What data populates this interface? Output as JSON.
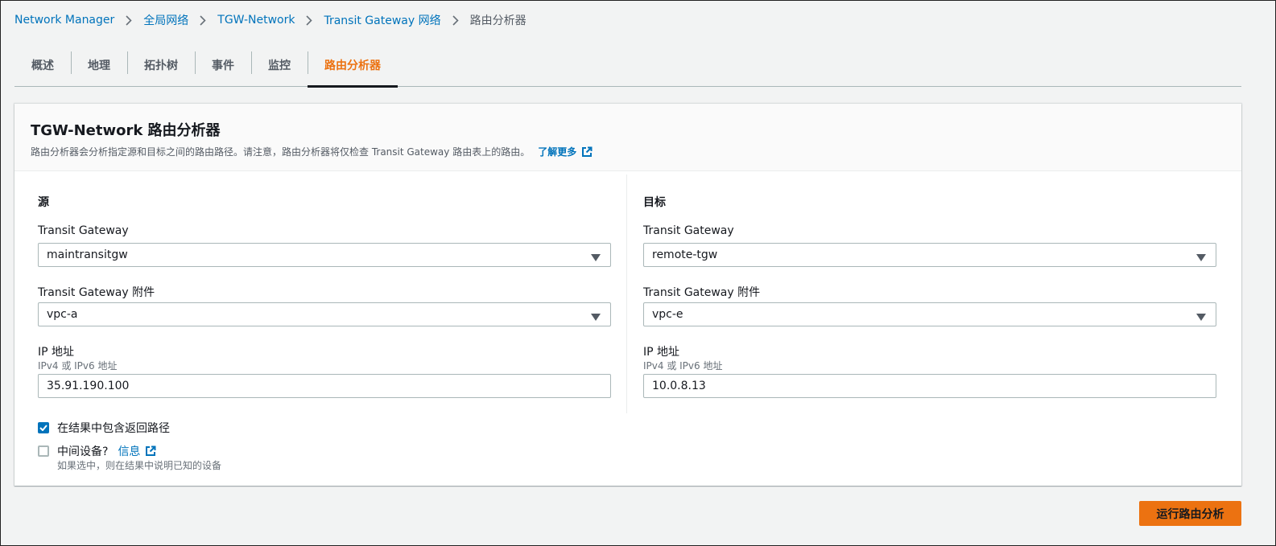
{
  "breadcrumb": [
    {
      "label": "Network Manager"
    },
    {
      "label": "全局网络"
    },
    {
      "label": "TGW-Network"
    },
    {
      "label": "Transit Gateway 网络"
    },
    {
      "label": "路由分析器"
    }
  ],
  "tabs": [
    {
      "label": "概述"
    },
    {
      "label": "地理"
    },
    {
      "label": "拓扑树"
    },
    {
      "label": "事件"
    },
    {
      "label": "监控"
    },
    {
      "label": "路由分析器",
      "active": true
    }
  ],
  "panel": {
    "title": "TGW-Network 路由分析器",
    "description": "路由分析器会分析指定源和目标之间的路由路径。请注意，路由分析器将仅检查 Transit Gateway 路由表上的路由。",
    "learn_more": "了解更多"
  },
  "source": {
    "title": "源",
    "tgw_label": "Transit Gateway",
    "tgw_value": "maintransitgw",
    "attachment_label": "Transit Gateway 附件",
    "attachment_value": "vpc-a",
    "ip_label": "IP 地址",
    "ip_sub": "IPv4 或 IPv6 地址",
    "ip_value": "35.91.190.100"
  },
  "destination": {
    "title": "目标",
    "tgw_label": "Transit Gateway",
    "tgw_value": "remote-tgw",
    "attachment_label": "Transit Gateway 附件",
    "attachment_value": "vpc-e",
    "ip_label": "IP 地址",
    "ip_sub": "IPv4 或 IPv6 地址",
    "ip_value": "10.0.8.13"
  },
  "options": {
    "return_path_label": "在结果中包含返回路径",
    "return_path_checked": true,
    "middlebox_label": "中间设备?",
    "middlebox_checked": false,
    "info_label": "信息",
    "middlebox_desc": "如果选中，则在结果中说明已知的设备"
  },
  "actions": {
    "run_label": "运行路由分析"
  },
  "colors": {
    "accent": "#ec7211",
    "link": "#0073bb",
    "checkbox": "#0073bb"
  }
}
